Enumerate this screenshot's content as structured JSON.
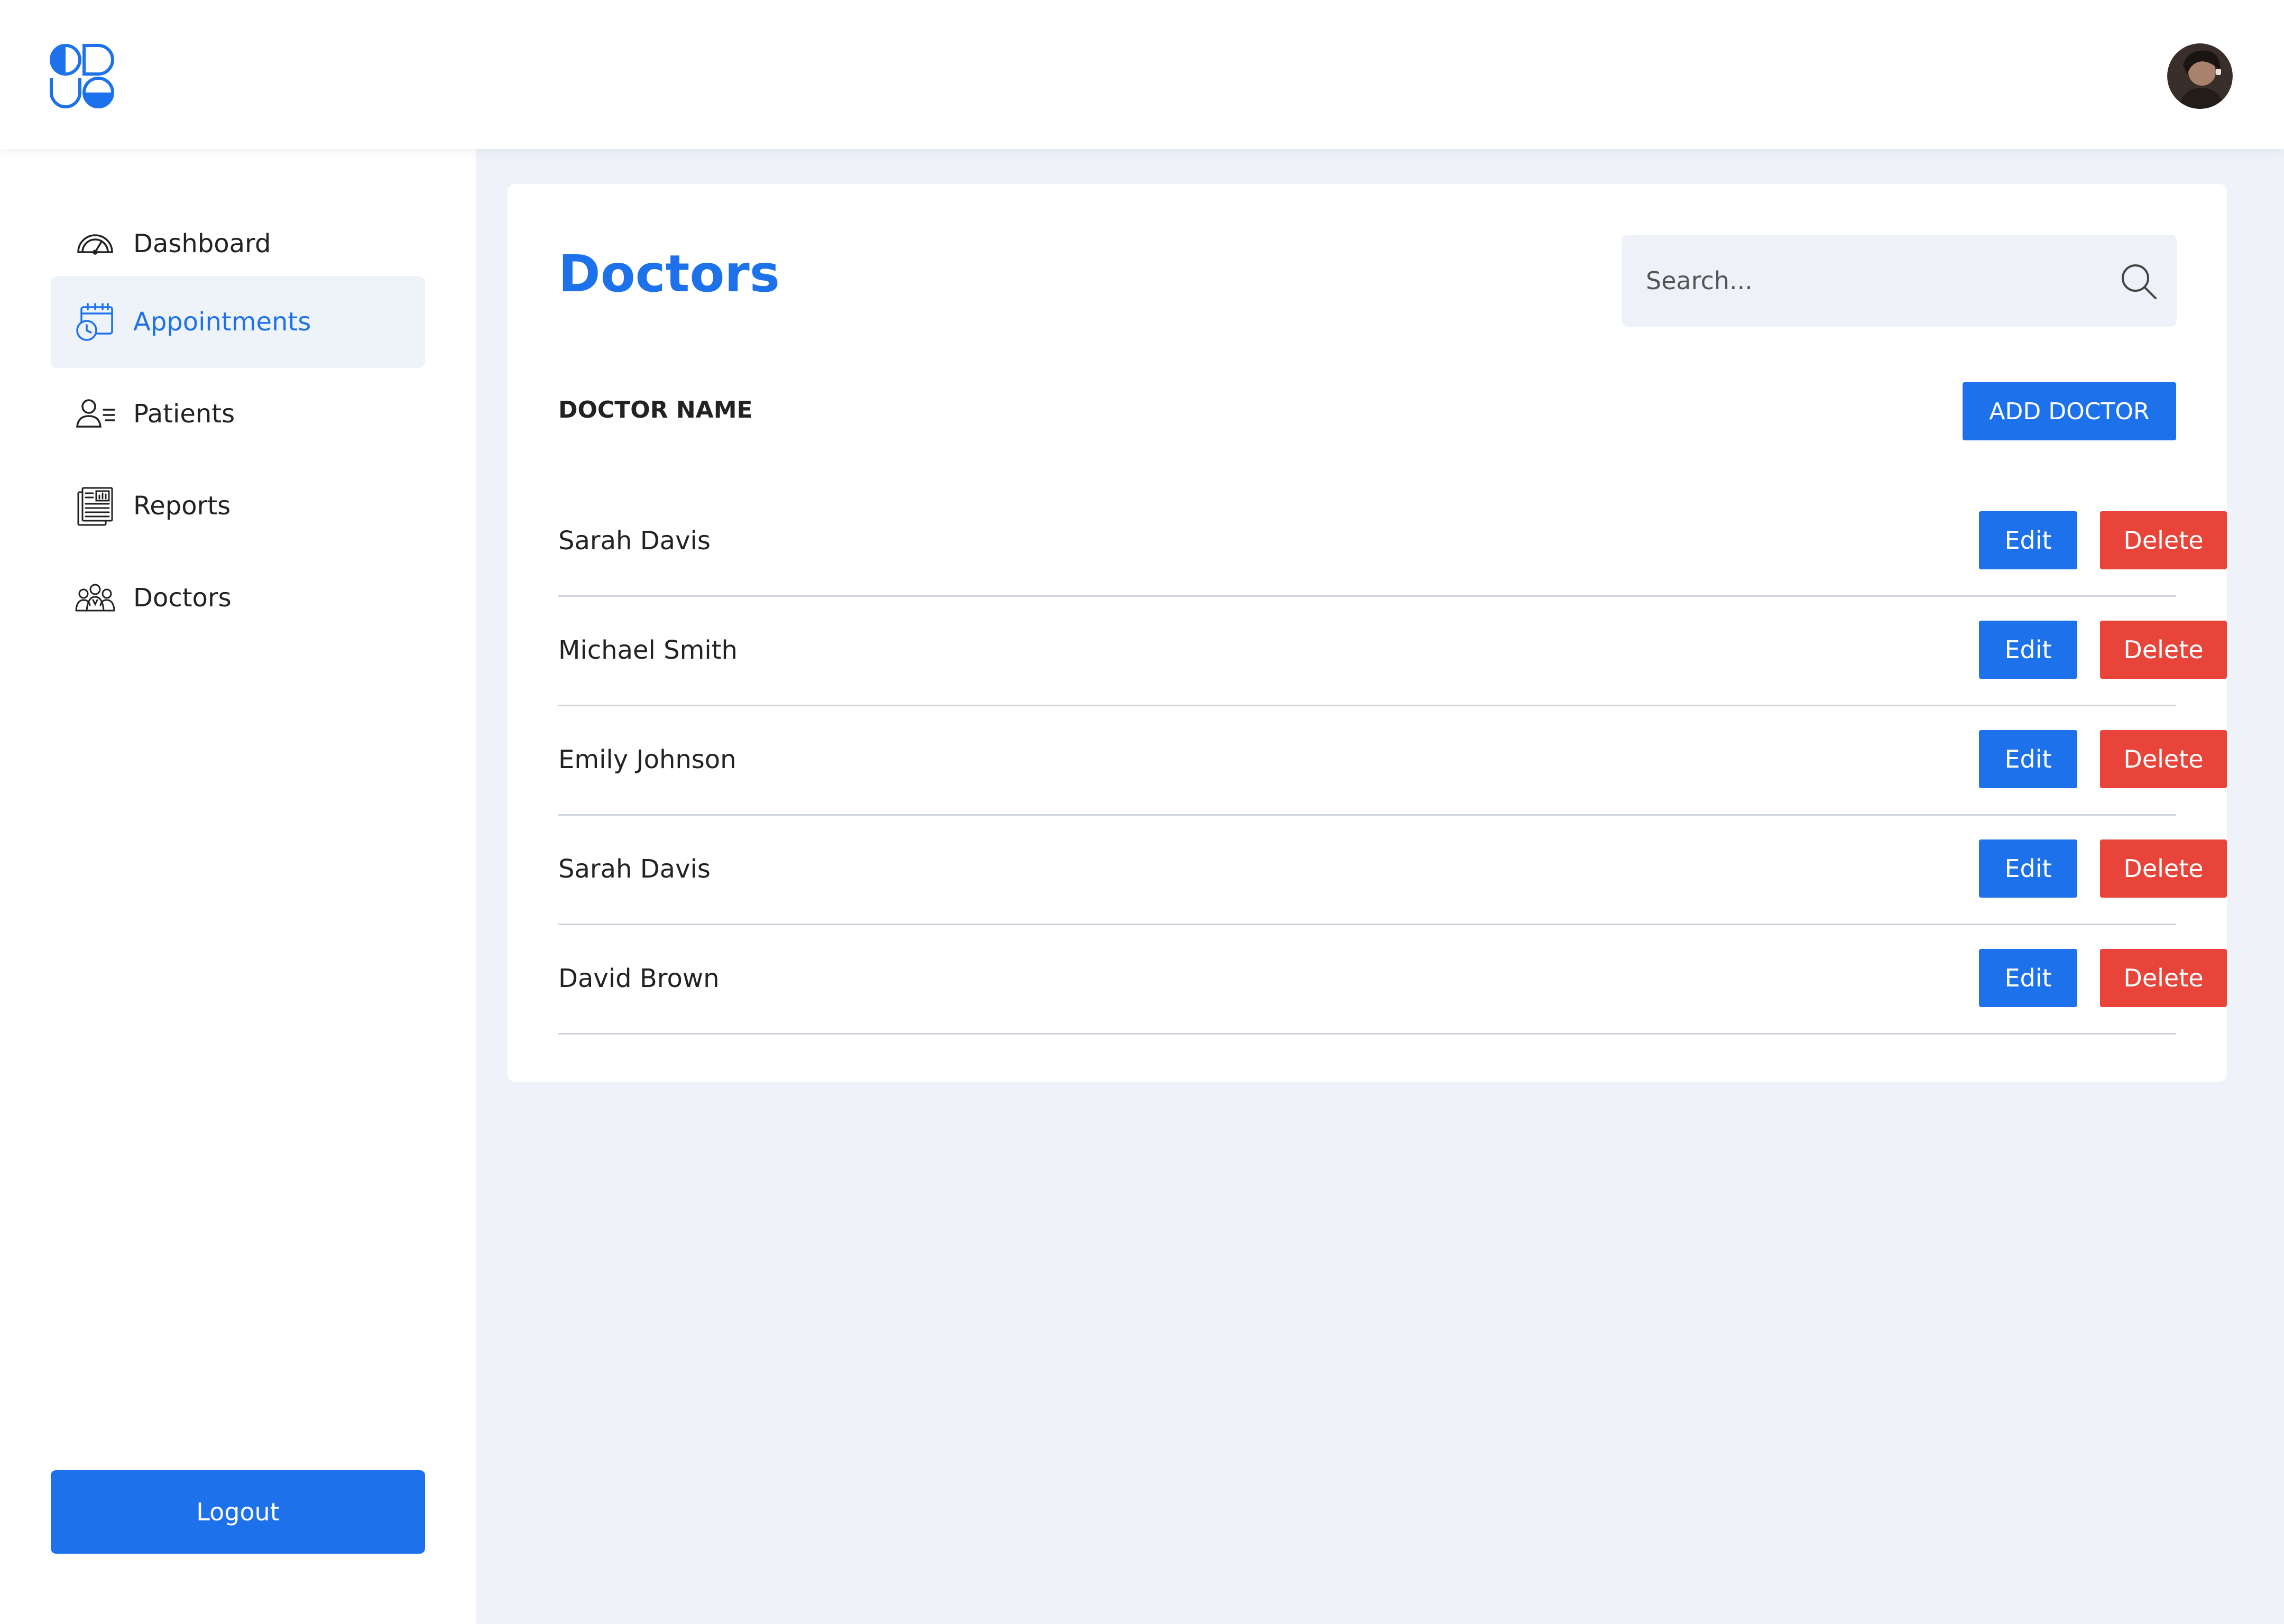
{
  "app": {
    "logo_icon": "app-logo-icon",
    "avatar_icon": "user-avatar"
  },
  "colors": {
    "primary": "#1d72ec",
    "danger": "#e8443a",
    "background": "#eff2f9",
    "active_nav_bg": "#eef2f9"
  },
  "sidebar": {
    "items": [
      {
        "label": "Dashboard",
        "icon": "gauge-icon",
        "active": false
      },
      {
        "label": "Appointments",
        "icon": "calendar-clock-icon",
        "active": true
      },
      {
        "label": "Patients",
        "icon": "user-list-icon",
        "active": false
      },
      {
        "label": "Reports",
        "icon": "report-chart-icon",
        "active": false
      },
      {
        "label": "Doctors",
        "icon": "group-icon",
        "active": false
      }
    ],
    "logout_label": "Logout"
  },
  "main": {
    "title": "Doctors",
    "search": {
      "placeholder": "Search..."
    },
    "column_header": "DOCTOR NAME",
    "add_button_label": "ADD DOCTOR",
    "edit_label": "Edit",
    "delete_label": "Delete",
    "rows": [
      {
        "name": "Sarah Davis"
      },
      {
        "name": "Michael Smith"
      },
      {
        "name": "Emily Johnson"
      },
      {
        "name": "Sarah Davis"
      },
      {
        "name": "David Brown"
      }
    ]
  }
}
